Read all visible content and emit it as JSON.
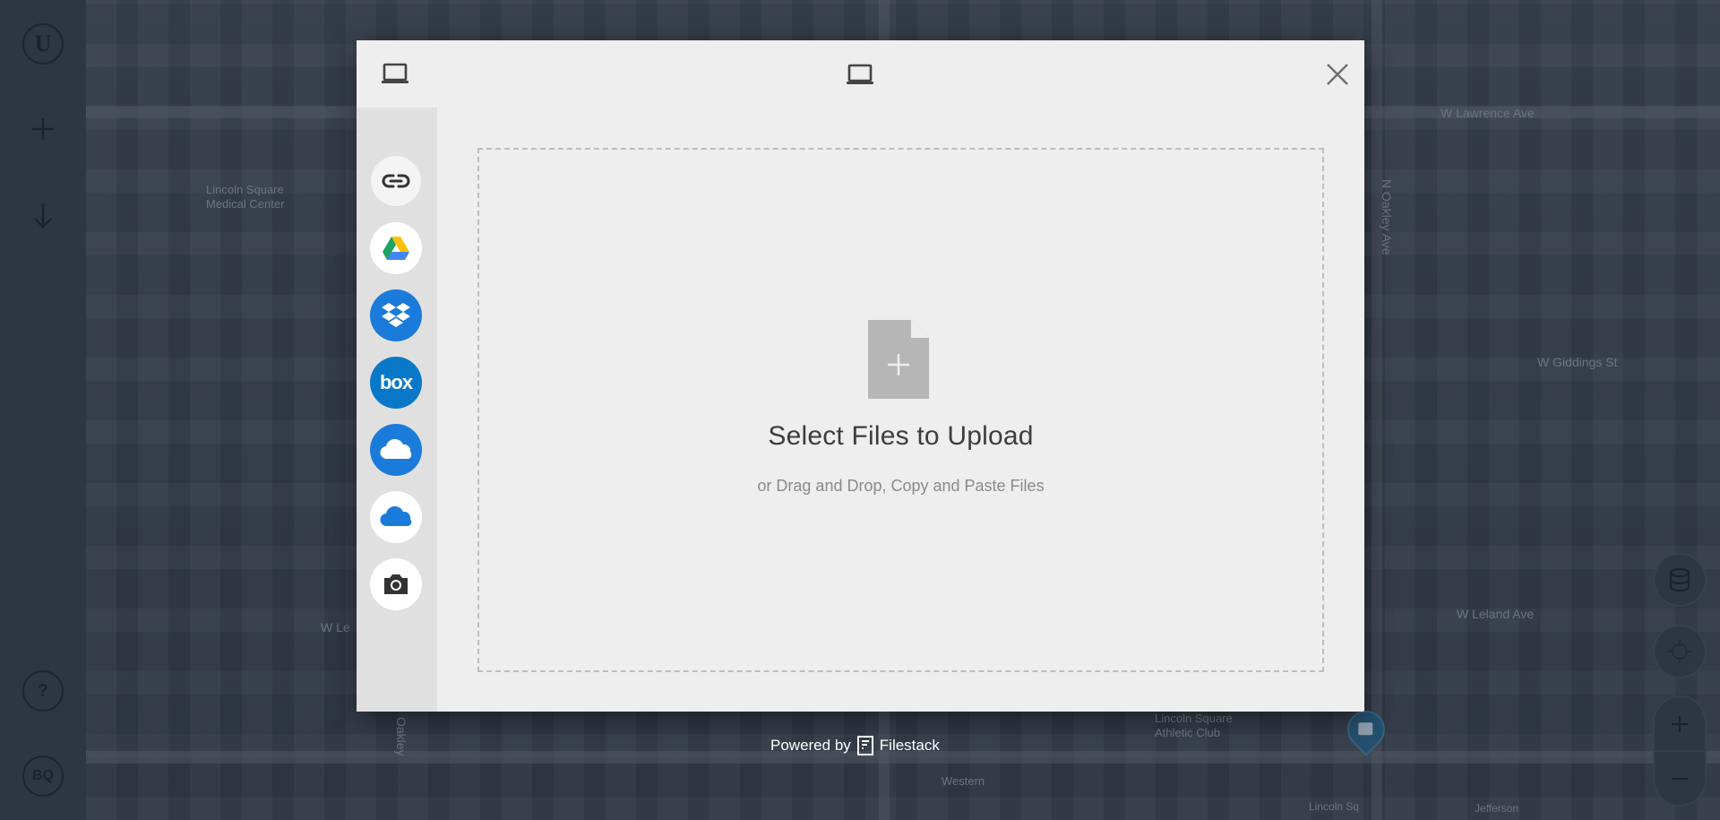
{
  "sidebar": {
    "logo_letter": "U",
    "help_label": "?",
    "bq_label": "BQ"
  },
  "map": {
    "labels": {
      "lincoln_square": "Lincoln Square",
      "medical_center": "Medical Center",
      "lawrence": "W Lawrence Ave",
      "giddings": "W Giddings St",
      "leland": "W Leland Ave",
      "oakley": "N Oakley Ave",
      "lincoln_athletic": "Lincoln Square",
      "athletic_club": "Athletic Club",
      "western": "Western",
      "lincoln_bottom": "Lincoln Sq",
      "jefferson": "Jefferson",
      "w_le": "W Le",
      "oakley_short": "Oakley"
    }
  },
  "picker": {
    "drop_title": "Select Files to Upload",
    "drop_subtitle": "or Drag and Drop, Copy and Paste Files",
    "close_label": "×",
    "sources": [
      {
        "name": "link"
      },
      {
        "name": "google-drive"
      },
      {
        "name": "dropbox"
      },
      {
        "name": "box",
        "text": "box"
      },
      {
        "name": "onedrive"
      },
      {
        "name": "onedrive-business"
      },
      {
        "name": "webcam"
      }
    ]
  },
  "footer": {
    "powered_by": "Powered by",
    "brand": "Filestack"
  },
  "colors": {
    "dropbox_blue": "#1a7bdb",
    "box_blue": "#0a78c8",
    "modal_bg": "#eeeeee",
    "sidebar_bg": "#e0e0e0"
  }
}
